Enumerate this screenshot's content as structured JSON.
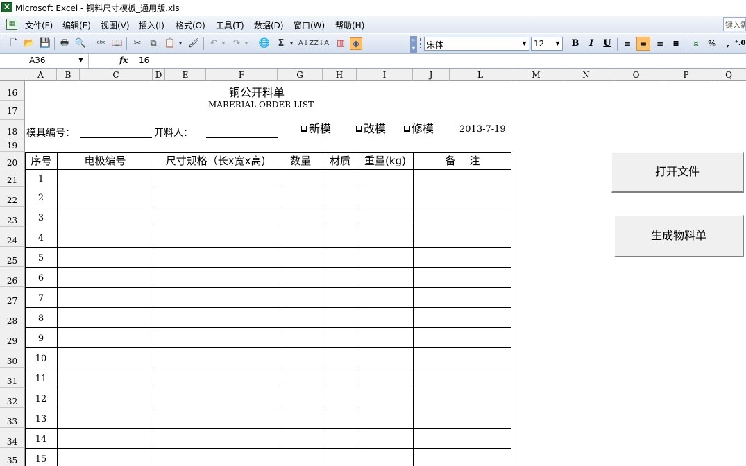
{
  "window": {
    "title": "Microsoft Excel - 铜料尺寸模板_通用版.xls"
  },
  "menu": {
    "items": [
      "文件(F)",
      "编辑(E)",
      "视图(V)",
      "插入(I)",
      "格式(O)",
      "工具(T)",
      "数据(D)",
      "窗口(W)",
      "帮助(H)"
    ],
    "help_placeholder": "键入需"
  },
  "toolbar": {
    "font_name": "宋体",
    "font_size": "12",
    "percent_label": "%",
    "comma_label": ",",
    "sum_label": "Σ"
  },
  "formula_bar": {
    "name_box": "A36",
    "fx_label": "fx",
    "value": "16"
  },
  "columns": [
    "A",
    "B",
    "C",
    "D",
    "E",
    "F",
    "G",
    "H",
    "I",
    "J",
    "L",
    "M",
    "N",
    "O",
    "P",
    "Q"
  ],
  "rows": [
    "16",
    "17",
    "18",
    "19",
    "20",
    "21",
    "22",
    "23",
    "24",
    "25",
    "26",
    "27",
    "28",
    "29",
    "30",
    "31",
    "32",
    "33",
    "34",
    "35"
  ],
  "sheet": {
    "title": "铜公开料单",
    "subtitle": "MARERIAL ORDER LIST",
    "mold_no_label": "模具编号：",
    "issuer_label": "开料人：",
    "checkboxes": [
      "新模",
      "改模",
      "修模"
    ],
    "date": "2013-7-19",
    "headers": [
      "序号",
      "电极编号",
      "尺寸规格（长x宽x高)",
      "数量",
      "材质",
      "重量(kg)",
      "备　 注"
    ],
    "row_numbers": [
      "1",
      "2",
      "3",
      "4",
      "5",
      "6",
      "7",
      "8",
      "9",
      "10",
      "11",
      "12",
      "13",
      "14",
      "15"
    ]
  },
  "buttons": {
    "open_file": "打开文件",
    "generate_list": "生成物料单"
  }
}
